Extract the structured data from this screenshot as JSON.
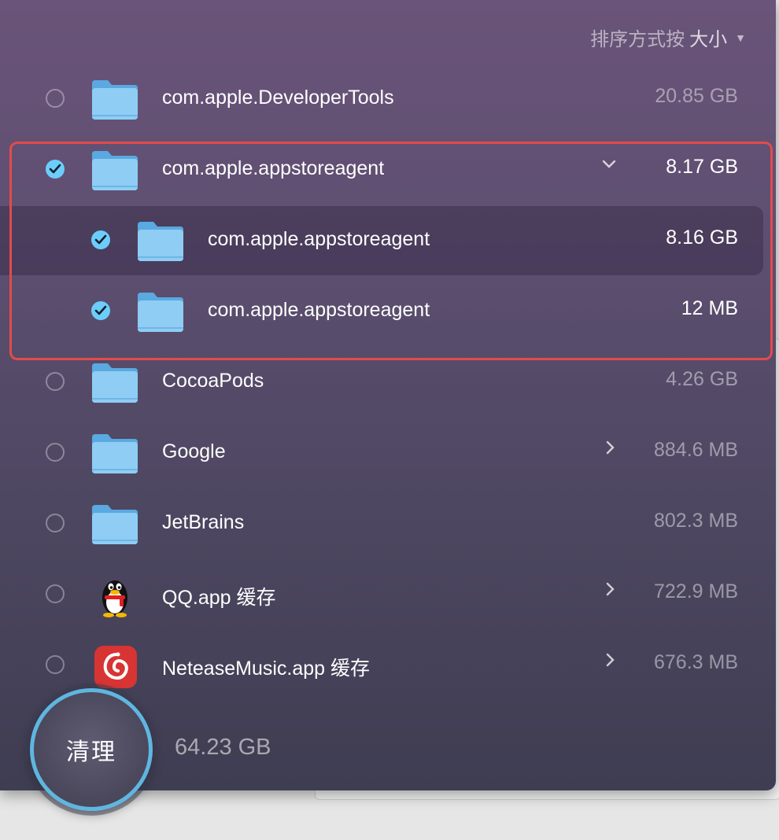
{
  "sort": {
    "label": "排序方式按",
    "value": "大小"
  },
  "rows": [
    {
      "name": "com.apple.DeveloperTools",
      "size": "20.85 GB",
      "checked": false,
      "icon": "folder-icon"
    },
    {
      "name": "com.apple.appstoreagent",
      "size": "8.17 GB",
      "checked": true,
      "icon": "folder-icon",
      "expanded": true
    },
    {
      "name": "com.apple.appstoreagent",
      "size": "8.16 GB",
      "checked": true,
      "icon": "folder-icon",
      "child": true
    },
    {
      "name": "com.apple.appstoreagent",
      "size": "12 MB",
      "checked": true,
      "icon": "folder-icon",
      "child": true
    },
    {
      "name": "CocoaPods",
      "size": "4.26 GB",
      "checked": false,
      "icon": "folder-icon"
    },
    {
      "name": "Google",
      "size": "884.6 MB",
      "checked": false,
      "icon": "folder-icon",
      "expandable": true
    },
    {
      "name": "JetBrains",
      "size": "802.3 MB",
      "checked": false,
      "icon": "folder-icon"
    },
    {
      "name": "QQ.app 缓存",
      "size": "722.9 MB",
      "checked": false,
      "icon": "qq-penguin-icon",
      "expandable": true
    },
    {
      "name": "NeteaseMusic.app 缓存",
      "size": "676.3 MB",
      "checked": false,
      "icon": "netease-music-icon",
      "expandable": true
    }
  ],
  "clean_button": "清理",
  "total_size": "64.23 GB",
  "colors": {
    "accent_check": "#6ccdfa",
    "highlight_border": "#e24b4b",
    "button_ring": "#5fb6e0"
  }
}
